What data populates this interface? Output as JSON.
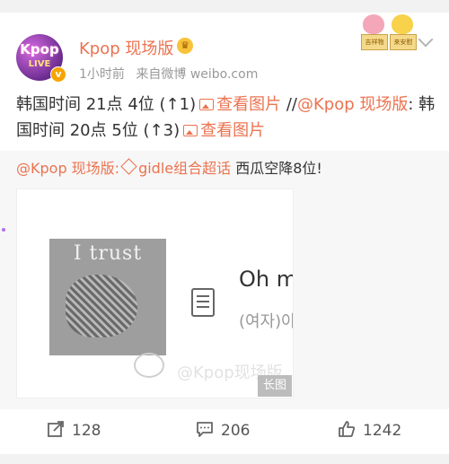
{
  "post": {
    "author": "Kpop 现场版",
    "avatar_text": "Kpop",
    "avatar_sub": "LIVE",
    "verified_mark": "v",
    "vip_mark": "♛",
    "time": "1小时前",
    "source": "来自微博 weibo.com",
    "stickers": [
      "吉祥物",
      "来安慰"
    ],
    "text": {
      "line1_prefix": "韩国时间 21点 4位 (↑1)",
      "view_pic_1": "查看图片",
      "separator": " //",
      "mention": "@Kpop 现场版",
      "line2_prefix": ": 韩国时间 20点 5位 (↑3)",
      "view_pic_2": "查看图片"
    }
  },
  "repost": {
    "mention": "@Kpop 现场版:",
    "topic": "gidle组合超话",
    "text": " 西瓜空降8位!",
    "card": {
      "album_title": "I trust",
      "song_title": "Oh my god",
      "song_sub": "(여자)아이들",
      "watermark": "@Kpop现场版",
      "long_image_badge": "长图"
    }
  },
  "actions": {
    "repost_count": "128",
    "comment_count": "206",
    "like_count": "1242"
  },
  "colors": {
    "accent": "#eb7350",
    "meta": "#999999",
    "repost_bg": "#f7f7f7"
  }
}
